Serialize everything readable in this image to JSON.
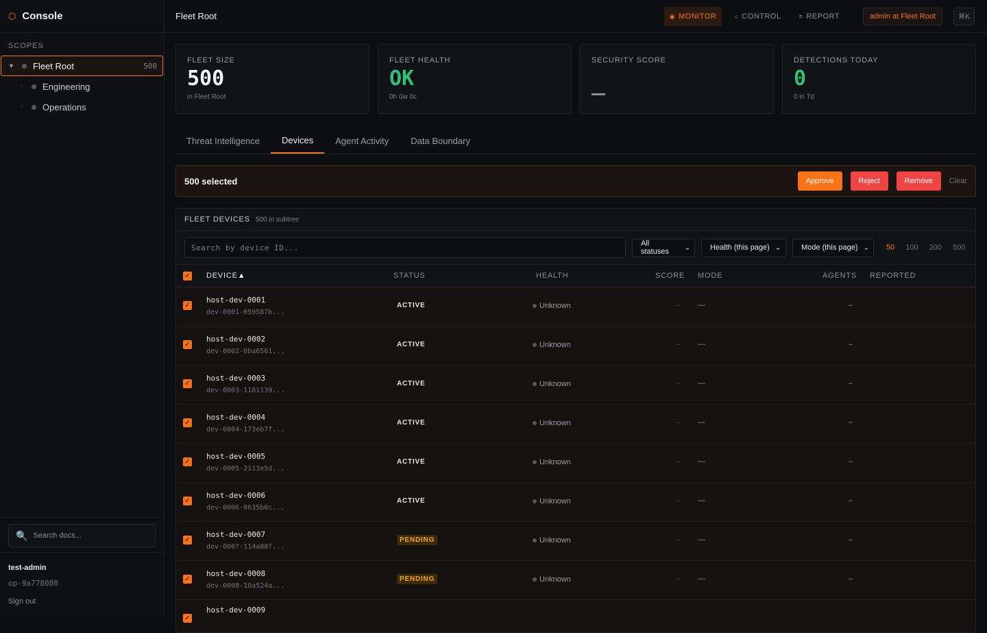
{
  "sidebar": {
    "brand": "Console",
    "scopes_label": "SCOPES",
    "scopes": [
      {
        "label": "Fleet Root",
        "count": "500"
      },
      {
        "label": "Engineering"
      },
      {
        "label": "Operations"
      }
    ],
    "doc_search_placeholder": "Search docs...",
    "user": {
      "name": "test-admin",
      "id": "op-9a778080",
      "signout": "Sign out"
    }
  },
  "header": {
    "title": "Fleet Root",
    "nav": [
      {
        "label": "MONITOR",
        "icon": "record-icon"
      },
      {
        "label": "CONTROL",
        "icon": "circle-icon"
      },
      {
        "label": "REPORT",
        "icon": "list-icon"
      }
    ],
    "admin_chip": "admin at Fleet Root",
    "shortcut": "⌘K"
  },
  "stats": [
    {
      "label": "FLEET SIZE",
      "value": "500",
      "sub": "in Fleet Root"
    },
    {
      "label": "FLEET HEALTH",
      "value": "OK",
      "sub": "0h 0w 0c"
    },
    {
      "label": "SECURITY SCORE",
      "value": "",
      "sub": ""
    },
    {
      "label": "DETECTIONS TODAY",
      "value": "0",
      "sub": "0 in 7d"
    }
  ],
  "tabs": [
    "Threat Intelligence",
    "Devices",
    "Agent Activity",
    "Data Boundary"
  ],
  "selection": {
    "text": "500 selected",
    "approve": "Approve",
    "reject": "Reject",
    "remove": "Remove",
    "clear": "Clear"
  },
  "devices_panel": {
    "title": "FLEET DEVICES",
    "subtitle": "500 in subtree",
    "search_placeholder": "Search by device ID...",
    "filters": [
      "All statuses",
      "Health (this page)",
      "Mode (this page)"
    ],
    "page_sizes": [
      "50",
      "100",
      "200",
      "500"
    ],
    "columns": {
      "device": "DEVICE▲",
      "status": "STATUS",
      "health": "HEALTH",
      "score": "SCORE",
      "mode": "MODE",
      "agents": "AGENTS",
      "reported": "REPORTED"
    },
    "rows": [
      {
        "name": "host-dev-0001",
        "id": "dev-0001-059587b...",
        "status": "ACTIVE",
        "health": "Unknown",
        "score": "–",
        "mode": "—",
        "agents": "–"
      },
      {
        "name": "host-dev-0002",
        "id": "dev-0002-0ba6561...",
        "status": "ACTIVE",
        "health": "Unknown",
        "score": "–",
        "mode": "—",
        "agents": "–"
      },
      {
        "name": "host-dev-0003",
        "id": "dev-0003-1181139...",
        "status": "ACTIVE",
        "health": "Unknown",
        "score": "–",
        "mode": "—",
        "agents": "–"
      },
      {
        "name": "host-dev-0004",
        "id": "dev-0004-173eb7f...",
        "status": "ACTIVE",
        "health": "Unknown",
        "score": "–",
        "mode": "—",
        "agents": "–"
      },
      {
        "name": "host-dev-0005",
        "id": "dev-0005-2113e5d...",
        "status": "ACTIVE",
        "health": "Unknown",
        "score": "–",
        "mode": "—",
        "agents": "–"
      },
      {
        "name": "host-dev-0006",
        "id": "dev-0006-0635b0c...",
        "status": "ACTIVE",
        "health": "Unknown",
        "score": "–",
        "mode": "—",
        "agents": "–"
      },
      {
        "name": "host-dev-0007",
        "id": "dev-0007-114a88f...",
        "status": "PENDING",
        "health": "Unknown",
        "score": "–",
        "mode": "—",
        "agents": "–"
      },
      {
        "name": "host-dev-0008",
        "id": "dev-0008-10a524a...",
        "status": "PENDING",
        "health": "Unknown",
        "score": "–",
        "mode": "—",
        "agents": "–"
      },
      {
        "name": "host-dev-0009",
        "id": "",
        "status": "",
        "health": "",
        "score": "",
        "mode": "",
        "agents": ""
      }
    ]
  }
}
